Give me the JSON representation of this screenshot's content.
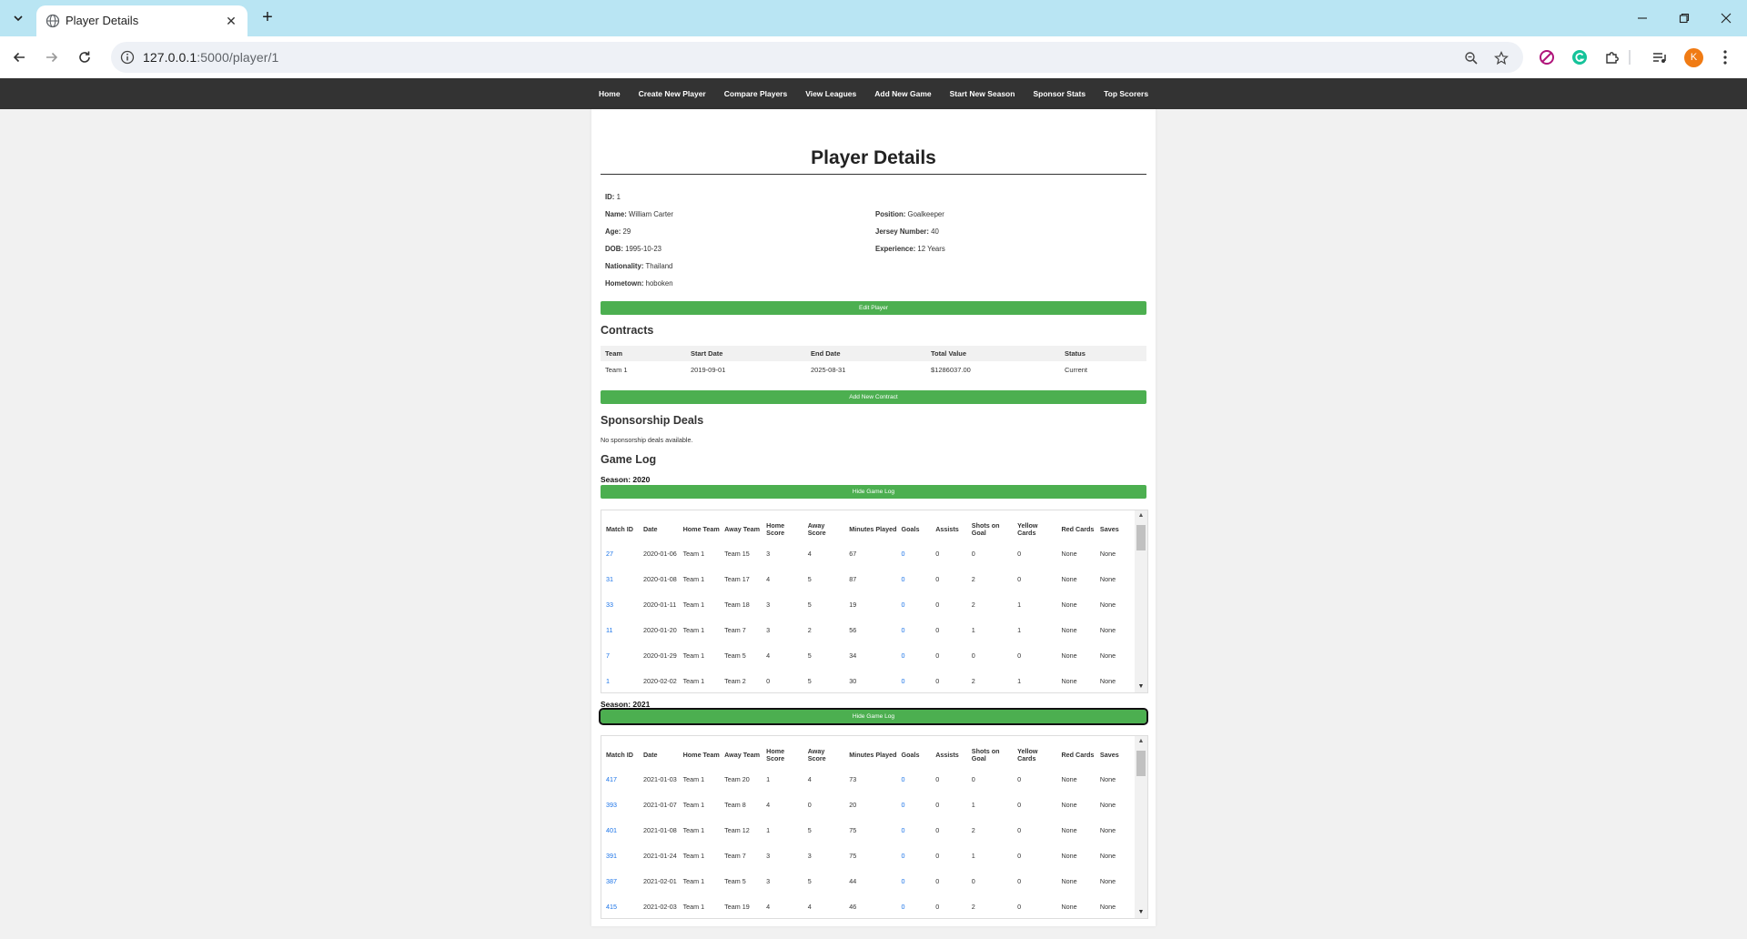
{
  "browser": {
    "tab_title": "Player Details",
    "url_host": "127.0.0.1",
    "url_rest": ":5000/player/1",
    "avatar_letter": "K"
  },
  "nav": [
    "Home",
    "Create New Player",
    "Compare Players",
    "View Leagues",
    "Add New Game",
    "Start New Season",
    "Sponsor Stats",
    "Top Scorers"
  ],
  "page_title": "Player Details",
  "player": {
    "id_label": "ID:",
    "id": "1",
    "name_label": "Name:",
    "name": "William Carter",
    "age_label": "Age:",
    "age": "29",
    "dob_label": "DOB:",
    "dob": "1995-10-23",
    "nationality_label": "Nationality:",
    "nationality": "Thailand",
    "hometown_label": "Hometown:",
    "hometown": "hoboken",
    "position_label": "Position:",
    "position": "Goalkeeper",
    "jersey_label": "Jersey Number:",
    "jersey": "40",
    "experience_label": "Experience:",
    "experience": "12 Years"
  },
  "edit_button": "Edit Player",
  "contracts": {
    "heading": "Contracts",
    "columns": [
      "Team",
      "Start Date",
      "End Date",
      "Total Value",
      "Status"
    ],
    "rows": [
      [
        "Team 1",
        "2019-09-01",
        "2025-08-31",
        "$1286037.00",
        "Current"
      ]
    ],
    "add_button": "Add New Contract"
  },
  "sponsorship": {
    "heading": "Sponsorship Deals",
    "empty_text": "No sponsorship deals available."
  },
  "game_log": {
    "heading": "Game Log",
    "hide_button": "Hide Game Log",
    "columns": [
      "Match ID",
      "Date",
      "Home Team",
      "Away Team",
      "Home Score",
      "Away Score",
      "Minutes Played",
      "Goals",
      "Assists",
      "Shots on Goal",
      "Yellow Cards",
      "Red Cards",
      "Saves"
    ],
    "seasons": [
      {
        "label": "Season: 2020",
        "rows": [
          [
            "27",
            "2020-01-06",
            "Team 1",
            "Team 15",
            "3",
            "4",
            "67",
            "0",
            "0",
            "0",
            "0",
            "None",
            "None"
          ],
          [
            "31",
            "2020-01-08",
            "Team 1",
            "Team 17",
            "4",
            "5",
            "87",
            "0",
            "0",
            "2",
            "0",
            "None",
            "None"
          ],
          [
            "33",
            "2020-01-11",
            "Team 1",
            "Team 18",
            "3",
            "5",
            "19",
            "0",
            "0",
            "2",
            "1",
            "None",
            "None"
          ],
          [
            "11",
            "2020-01-20",
            "Team 1",
            "Team 7",
            "3",
            "2",
            "56",
            "0",
            "0",
            "1",
            "1",
            "None",
            "None"
          ],
          [
            "7",
            "2020-01-29",
            "Team 1",
            "Team 5",
            "4",
            "5",
            "34",
            "0",
            "0",
            "0",
            "0",
            "None",
            "None"
          ],
          [
            "1",
            "2020-02-02",
            "Team 1",
            "Team 2",
            "0",
            "5",
            "30",
            "0",
            "0",
            "2",
            "1",
            "None",
            "None"
          ]
        ]
      },
      {
        "label": "Season: 2021",
        "rows": [
          [
            "417",
            "2021-01-03",
            "Team 1",
            "Team 20",
            "1",
            "4",
            "73",
            "0",
            "0",
            "0",
            "0",
            "None",
            "None"
          ],
          [
            "393",
            "2021-01-07",
            "Team 1",
            "Team 8",
            "4",
            "0",
            "20",
            "0",
            "0",
            "1",
            "0",
            "None",
            "None"
          ],
          [
            "401",
            "2021-01-08",
            "Team 1",
            "Team 12",
            "1",
            "5",
            "75",
            "0",
            "0",
            "2",
            "0",
            "None",
            "None"
          ],
          [
            "391",
            "2021-01-24",
            "Team 1",
            "Team 7",
            "3",
            "3",
            "75",
            "0",
            "0",
            "1",
            "0",
            "None",
            "None"
          ],
          [
            "387",
            "2021-02-01",
            "Team 1",
            "Team 5",
            "3",
            "5",
            "44",
            "0",
            "0",
            "0",
            "0",
            "None",
            "None"
          ],
          [
            "415",
            "2021-02-03",
            "Team 1",
            "Team 19",
            "4",
            "4",
            "46",
            "0",
            "0",
            "2",
            "0",
            "None",
            "None"
          ]
        ]
      }
    ]
  }
}
